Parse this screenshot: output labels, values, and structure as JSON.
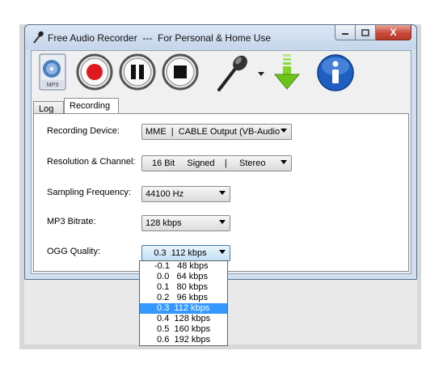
{
  "window": {
    "title": "Free Audio Recorder  ---  For Personal & Home Use",
    "close_glyph": "X"
  },
  "toolbar": {
    "mp3_icon_label": "MP3",
    "buttons": [
      "mp3-file-icon",
      "record-icon",
      "pause-icon",
      "stop-icon",
      "microphone-icon",
      "download-icon",
      "info-icon"
    ],
    "record_color": "#e01820",
    "download_color": "#7fd624",
    "info_color": "#1f5fc4"
  },
  "tabs": [
    {
      "label": "Log",
      "active": false
    },
    {
      "label": "Recording",
      "active": true
    }
  ],
  "fields": {
    "recording_device": {
      "label": "Recording Device:",
      "value": "MME  |  CABLE Output (VB-Audio"
    },
    "resolution_channel": {
      "label": "Resolution & Channel:",
      "value": "16 Bit     Signed    |     Stereo"
    },
    "sampling_frequency": {
      "label": "Sampling Frequency:",
      "value": "44100 Hz"
    },
    "mp3_bitrate": {
      "label": "MP3 Bitrate:",
      "value": "128 kbps"
    },
    "ogg_quality": {
      "label": "OGG Quality:",
      "value": "0.3  112 kbps"
    }
  },
  "ogg_options": [
    "-0.1   48 kbps",
    " 0.0   64 kbps",
    " 0.1   80 kbps",
    " 0.2   96 kbps",
    " 0.3  112 kbps",
    " 0.4  128 kbps",
    " 0.5  160 kbps",
    " 0.6  192 kbps"
  ],
  "ogg_selected_index": 4
}
